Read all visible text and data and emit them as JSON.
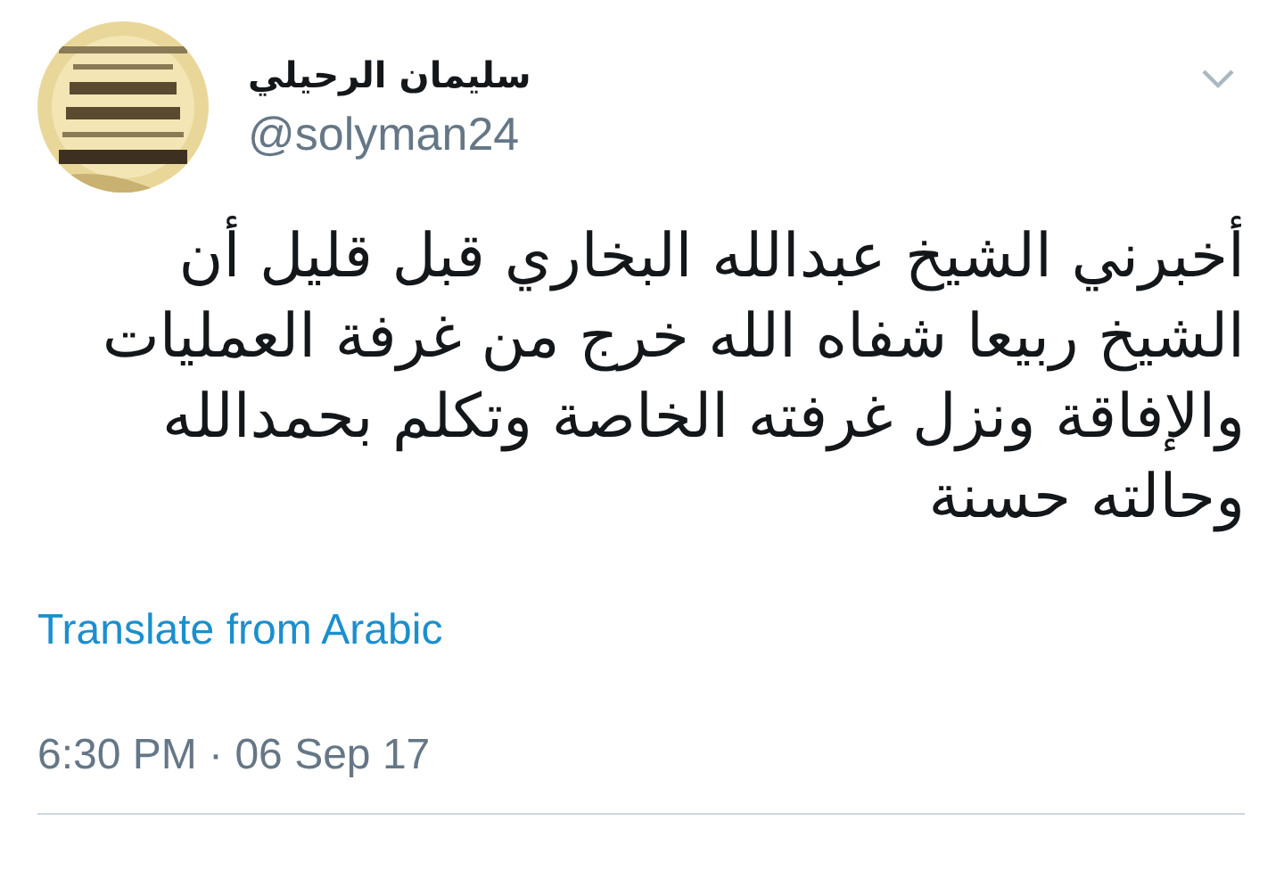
{
  "author": {
    "name": "سليمان الرحيلي",
    "handle": "@solyman24"
  },
  "tweet": {
    "text": "أخبرني الشيخ عبدالله البخاري قبل قليل أن الشيخ ربيعا شفاه الله خرج من غرفة العمليات والإفاقة ونزل غرفته الخاصة وتكلم بحمدالله وحالته حسنة",
    "translate_link": "Translate from Arabic",
    "timestamp": "6:30 PM · 06 Sep 17"
  }
}
